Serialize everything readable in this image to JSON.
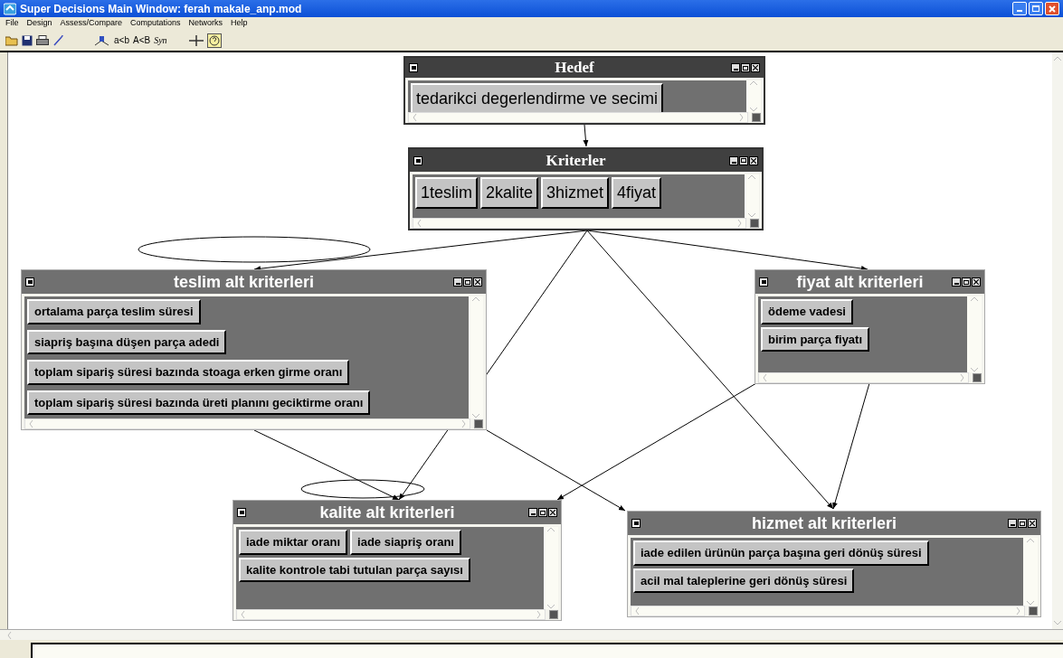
{
  "window": {
    "title": "Super Decisions Main Window: ferah makale_anp.mod"
  },
  "menu": [
    "File",
    "Design",
    "Assess/Compare",
    "Computations",
    "Networks",
    "Help"
  ],
  "toolbar": {
    "text_buttons": [
      "a<b",
      "A<B",
      "Syn"
    ]
  },
  "clusters": [
    {
      "title": "Hedef",
      "nodes": [
        "tedarikci degerlendirme ve secimi"
      ]
    },
    {
      "title": "Kriterler",
      "nodes": [
        "1teslim",
        "2kalite",
        "3hizmet",
        "4fiyat"
      ]
    },
    {
      "title": "teslim alt kriterleri",
      "nodes": [
        "ortalama parça teslim süresi",
        "siapriş başına düşen parça adedi",
        "toplam sipariş süresi bazında stoaga erken girme oranı",
        "toplam sipariş süresi bazında üreti planını geciktirme oranı"
      ]
    },
    {
      "title": "fiyat alt kriterleri",
      "nodes": [
        "ödeme vadesi",
        "birim parça fiyatı"
      ]
    },
    {
      "title": "kalite alt kriterleri",
      "nodes": [
        "iade miktar oranı",
        "iade siapriş oranı",
        "kalite kontrole tabi tutulan parça sayısı"
      ]
    },
    {
      "title": "hizmet alt kriterleri",
      "nodes": [
        "iade edilen ürünün parça başına geri dönüş süresi",
        "acil mal taleplerine geri dönüş süresi"
      ]
    }
  ]
}
